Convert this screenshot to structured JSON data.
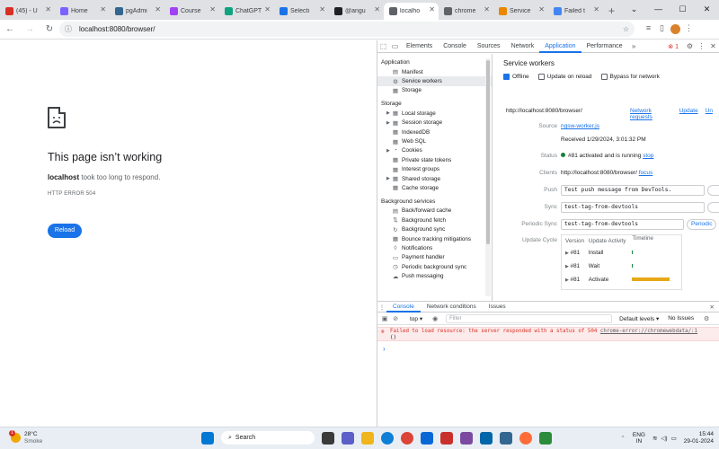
{
  "browser": {
    "tabs": [
      {
        "title": "(45) - U",
        "color": "#d93025"
      },
      {
        "title": "Home",
        "color": "#7b61ff"
      },
      {
        "title": "pgAdmi",
        "color": "#326690"
      },
      {
        "title": "Course",
        "color": "#a142f4"
      },
      {
        "title": "ChatGPT",
        "color": "#10a37f"
      },
      {
        "title": "Selecti",
        "color": "#1a73e8"
      },
      {
        "title": "@angu",
        "color": "#202124"
      },
      {
        "title": "localho",
        "color": "#5f6368"
      },
      {
        "title": "chrome",
        "color": "#5f6368"
      },
      {
        "title": "Service",
        "color": "#ea8600"
      },
      {
        "title": "Failed t",
        "color": "#4285f4"
      }
    ],
    "active_tab_index": 7,
    "url": "localhost:8080/browser/"
  },
  "error_page": {
    "title": "This page isn’t working",
    "host": "localhost",
    "message": " took too long to respond.",
    "code": "HTTP ERROR 504",
    "reload_label": "Reload"
  },
  "devtools": {
    "tabs": [
      "Elements",
      "Console",
      "Sources",
      "Network",
      "Application",
      "Performance"
    ],
    "active_tab": "Application",
    "error_count": "1",
    "sidebar": {
      "application_header": "Application",
      "application_items": [
        "Manifest",
        "Service workers",
        "Storage"
      ],
      "storage_header": "Storage",
      "storage_items": [
        "Local storage",
        "Session storage",
        "IndexedDB",
        "Web SQL",
        "Cookies",
        "Private state tokens",
        "Interest groups",
        "Shared storage",
        "Cache storage"
      ],
      "bg_header": "Background services",
      "bg_items": [
        "Back/forward cache",
        "Background fetch",
        "Background sync",
        "Bounce tracking mitigations",
        "Notifications",
        "Payment handler",
        "Periodic background sync",
        "Push messaging"
      ]
    },
    "service_workers": {
      "title": "Service workers",
      "offline_label": "Offline",
      "update_on_reload_label": "Update on reload",
      "bypass_label": "Bypass for network",
      "scope": "http://localhost:8080/browser/",
      "links": [
        "Network requests",
        "Update",
        "Un"
      ],
      "source_label": "Source",
      "source_file": "ngsw-worker.js",
      "received": "Received 1/29/2024, 3:01:32 PM",
      "status_label": "Status",
      "status_text": "#81 activated and is running",
      "stop_label": "stop",
      "clients_label": "Clients",
      "clients_value": "http://localhost:8080/browser/",
      "focus_label": "focus",
      "push_label": "Push",
      "push_value": "Test push message from DevTools.",
      "sync_label": "Sync",
      "sync_value": "test-tag-from-devtools",
      "periodic_label": "Periodic Sync",
      "periodic_value": "test-tag-from-devtools",
      "periodic_button": "Periodic",
      "update_cycle_label": "Update Cycle",
      "update_cycle_headers": [
        "Version",
        "Update Activity",
        "Timeline"
      ],
      "update_cycle_rows": [
        {
          "version": "#81",
          "activity": "Install"
        },
        {
          "version": "#81",
          "activity": "Wait"
        },
        {
          "version": "#81",
          "activity": "Activate"
        }
      ]
    },
    "drawer": {
      "tabs": [
        "Console",
        "Network conditions",
        "Issues"
      ],
      "context": "top",
      "filter_placeholder": "Filter",
      "levels": "Default levels",
      "issues": "No Issues",
      "error_text": "Failed to load resource: the server responded with a status of 504",
      "error_source": "chrome-error://chromewebdata/:1",
      "error_obj": "()"
    }
  },
  "taskbar": {
    "temperature": "28°C",
    "condition": "Smoke",
    "search_label": "Search",
    "lang_top": "ENG",
    "lang_bottom": "IN",
    "time": "15:44",
    "date": "29-01-2024",
    "notif": "1"
  }
}
